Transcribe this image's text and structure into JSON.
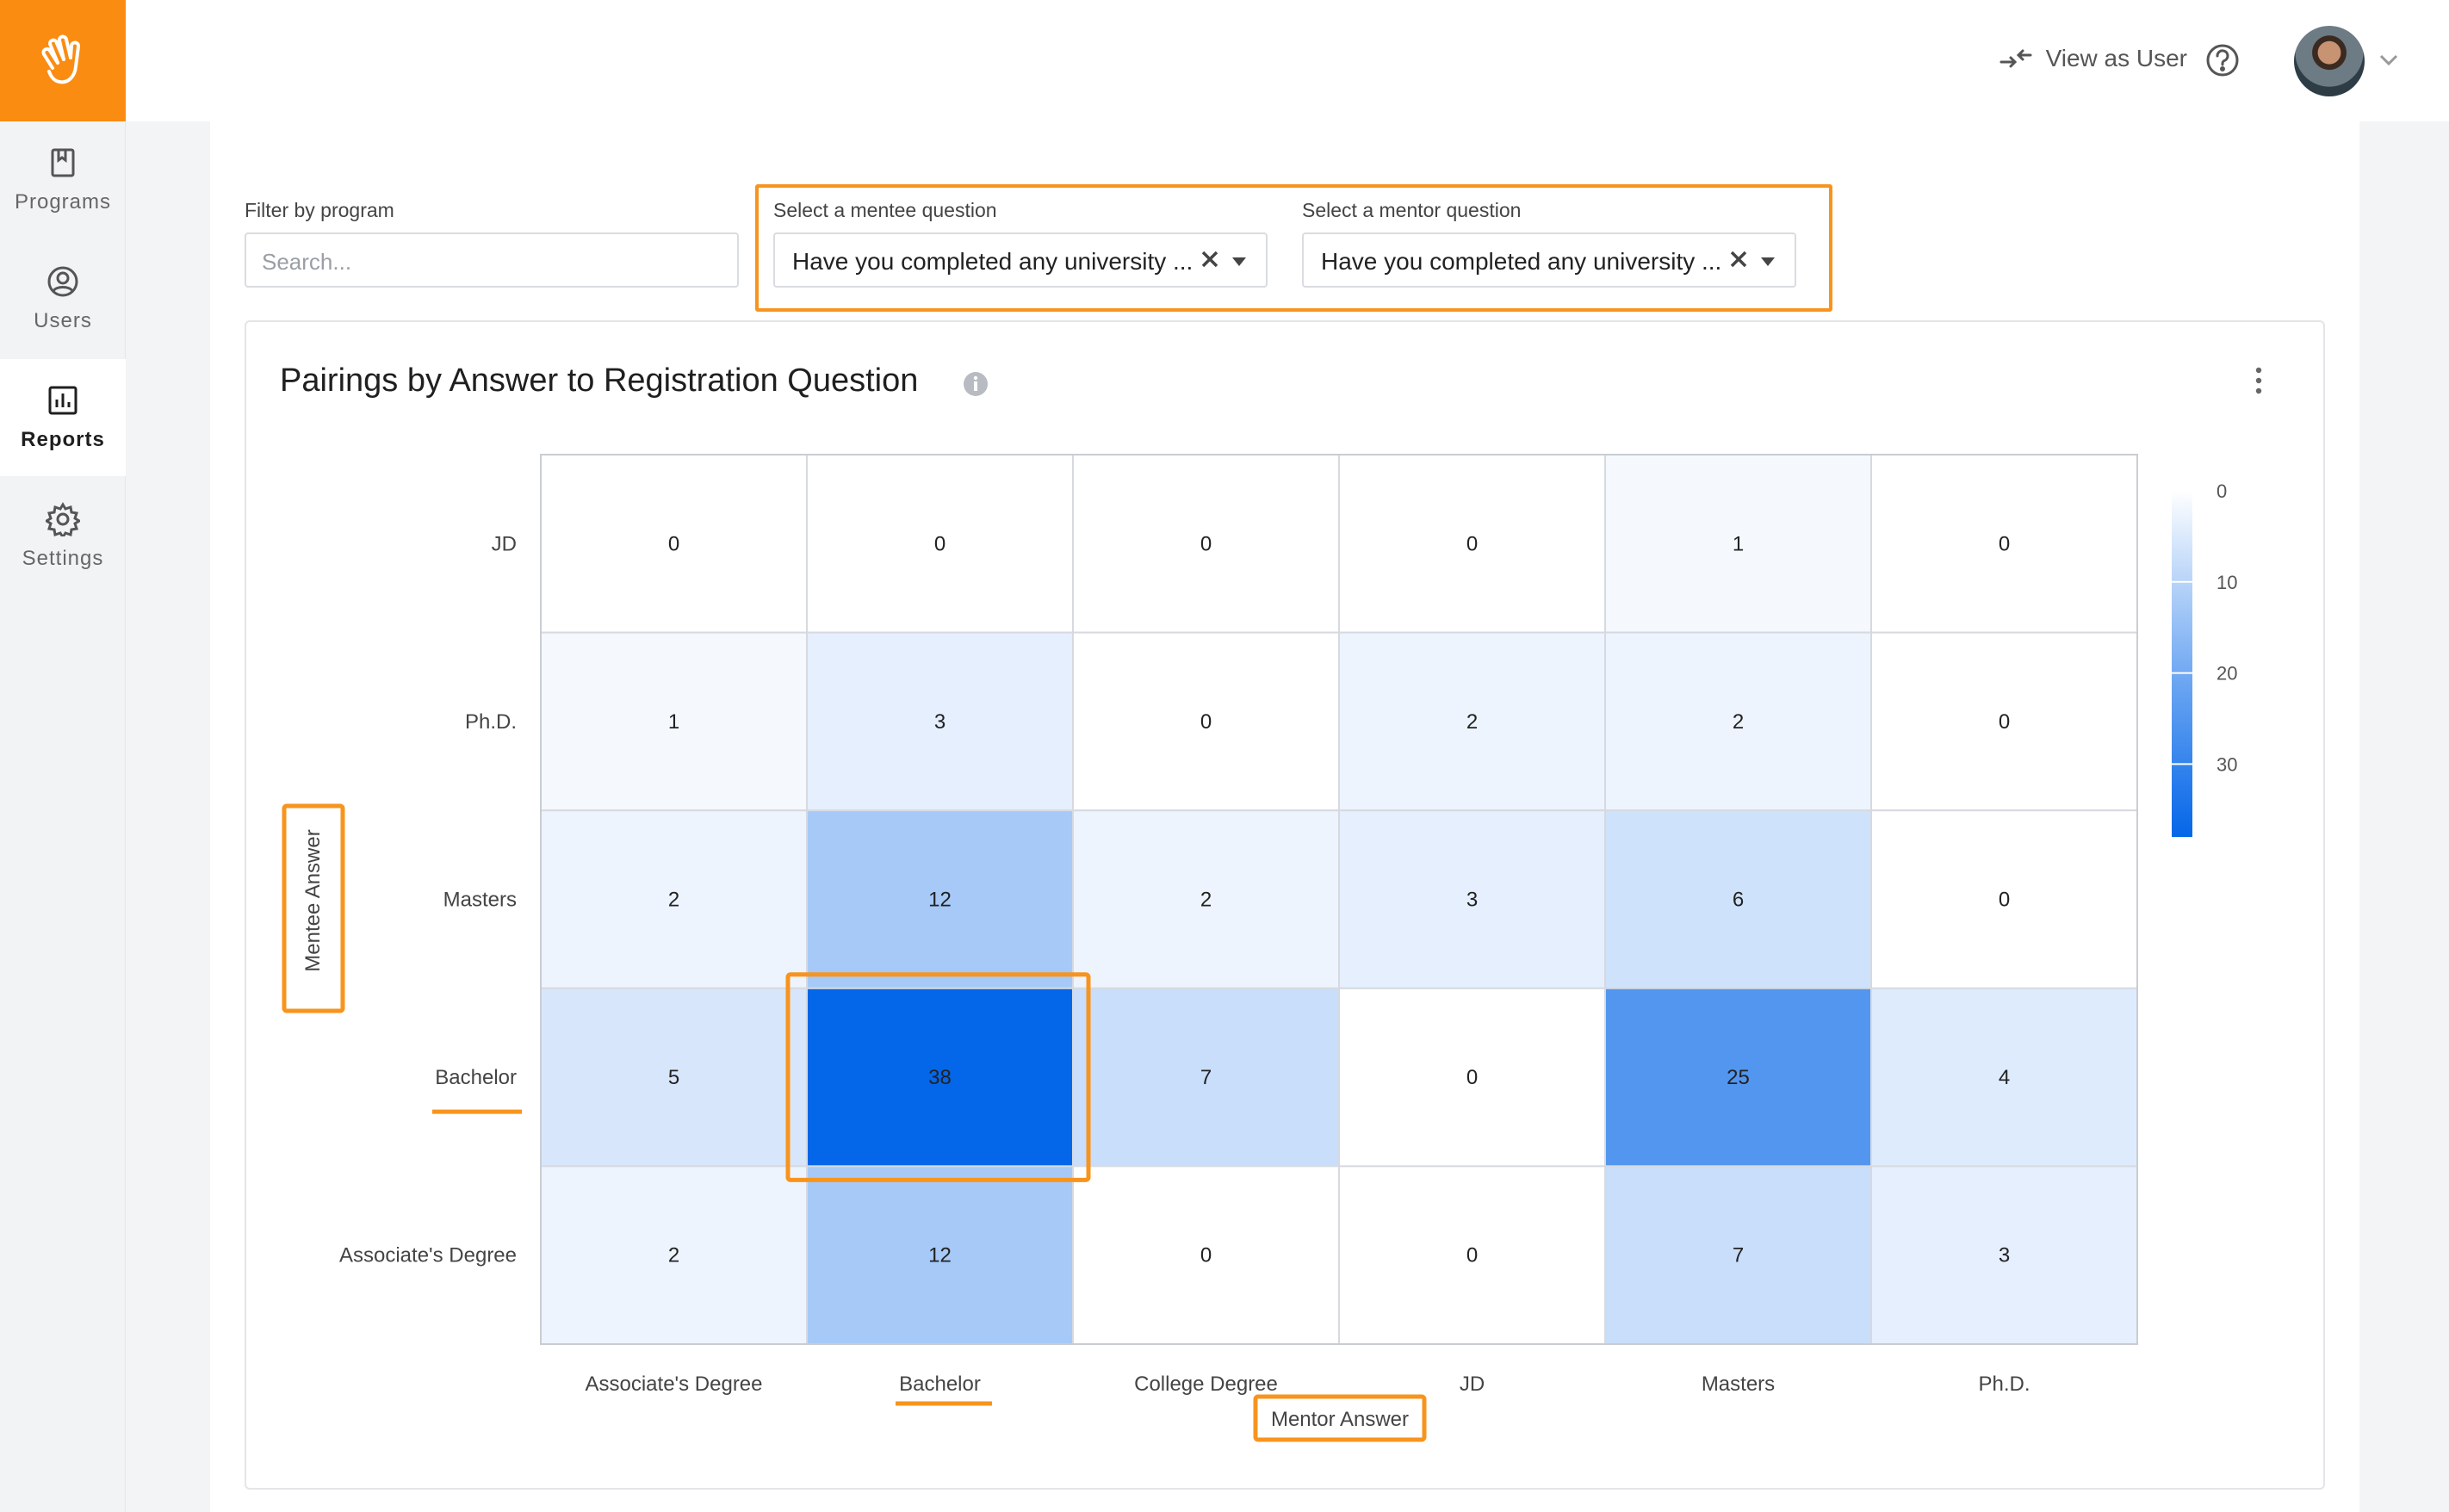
{
  "sidebar": {
    "logo_icon": "waving-hand-icon",
    "items": [
      {
        "label": "Programs",
        "icon": "bookmark-icon",
        "active": false
      },
      {
        "label": "Users",
        "icon": "user-circle-icon",
        "active": false
      },
      {
        "label": "Reports",
        "icon": "bar-chart-icon",
        "active": true
      },
      {
        "label": "Settings",
        "icon": "gear-icon",
        "active": false
      }
    ]
  },
  "topbar": {
    "view_as_label": "View as User",
    "help_icon": "question-circle-icon",
    "avatar_icon": "user-avatar"
  },
  "filters": {
    "program_label": "Filter by program",
    "program_placeholder": "Search...",
    "mentee_label": "Select a mentee question",
    "mentee_value": "Have you completed any university ...",
    "mentor_label": "Select a mentor question",
    "mentor_value": "Have you completed any university ..."
  },
  "card": {
    "title": "Pairings by Answer to Registration Question"
  },
  "colors": {
    "accent": "#f7941e",
    "brand": "#fb8c12",
    "heat_max": "#0466e8"
  },
  "chart_data": {
    "type": "heatmap",
    "title": "Pairings by Answer to Registration Question",
    "xlabel": "Mentor Answer",
    "ylabel": "Mentee Answer",
    "x_categories": [
      "Associate's Degree",
      "Bachelor",
      "College Degree",
      "JD",
      "Masters",
      "Ph.D."
    ],
    "y_categories": [
      "JD",
      "Ph.D.",
      "Masters",
      "Bachelor",
      "Associate's Degree"
    ],
    "values": [
      [
        0,
        0,
        0,
        0,
        1,
        0
      ],
      [
        1,
        3,
        0,
        2,
        2,
        0
      ],
      [
        2,
        12,
        2,
        3,
        6,
        0
      ],
      [
        5,
        38,
        7,
        0,
        25,
        4
      ],
      [
        2,
        12,
        0,
        0,
        7,
        3
      ]
    ],
    "colorbar": {
      "ticks": [
        0,
        10,
        20,
        30
      ],
      "min": 0,
      "max": 38
    },
    "highlighted_cell": {
      "row": "Bachelor",
      "col": "Bachelor"
    }
  }
}
